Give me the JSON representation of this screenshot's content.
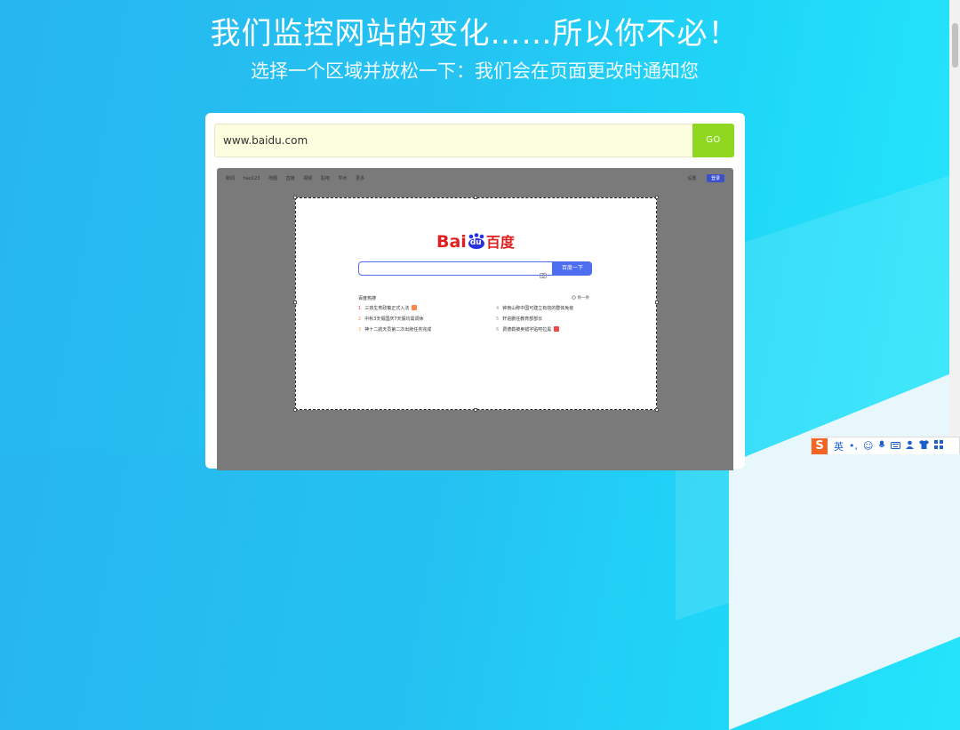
{
  "headline": "我们监控网站的变化……所以你不必！",
  "subline": "选择一个区域并放松一下：我们会在页面更改时通知您",
  "url_input": {
    "value": "www.baidu.com"
  },
  "go_label": "GO",
  "preview": {
    "topnav": [
      "新闻",
      "hao123",
      "地图",
      "直播",
      "视频",
      "贴吧",
      "学术",
      "更多"
    ],
    "settings_label": "设置",
    "login_label": "登录",
    "logo_text": "Bai",
    "logo_paw_text": "du",
    "logo_cn": "百度",
    "search_button": "百度一下",
    "hot_title": "百度热搜",
    "refresh_label": "换一换",
    "hot_items": [
      {
        "n": "1",
        "text": "三孩生育政策正式入法"
      },
      {
        "n": "2",
        "text": "中秋3天假国庆7天假均需调休"
      },
      {
        "n": "3",
        "text": "神十二航天员第二次出舱任务完成"
      },
      {
        "n": "4",
        "text": "钟南山称中国可建立有效的群体免疫"
      },
      {
        "n": "5",
        "text": "轩进鹏任教育部部长"
      },
      {
        "n": "6",
        "text": "费德勒被卖错字贴吧拉黑"
      }
    ],
    "colors": {
      "hot_red": "#f54545",
      "hot_orange": "#ff8547",
      "hot_gold": "#ffac38",
      "new_tag": "#ff6600"
    }
  },
  "ime": {
    "mode_label": "英",
    "icons": [
      "punctuation-icon",
      "emoji-icon",
      "microphone-icon",
      "keyboard-icon",
      "user-icon",
      "shirt-icon",
      "grid-icon"
    ]
  }
}
